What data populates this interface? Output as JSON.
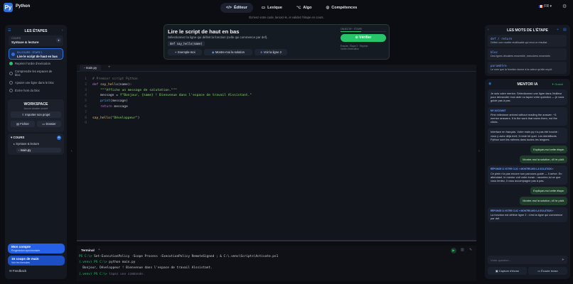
{
  "app": {
    "name": "Python",
    "logo_glyph": "Py"
  },
  "nav": {
    "tabs": [
      {
        "label": "Éditeur",
        "icon": "code-icon",
        "active": true
      },
      {
        "label": "Lexique",
        "icon": "book-icon",
        "active": false
      },
      {
        "label": "Algo",
        "icon": "diagram-icon",
        "active": false
      },
      {
        "label": "Compétences",
        "icon": "target-icon",
        "active": false
      }
    ],
    "subtitle": "Écrivez votre code, lancez-le, et validez l'étape en cours.",
    "lang": "FR",
    "lang_caret": "▾"
  },
  "left": {
    "title": "LES ÉTAPES",
    "course_label": "COURS",
    "course_value": "Syntaxe & lecture",
    "current_tag": "EN COURS · ÉTAPE 1",
    "current_label": "Lire le script de haut en bas",
    "steps": [
      "Repérer l'ordre d'exécution",
      "Comprendre les espaces de bloc",
      "Ajouter une ligne dans le bloc",
      "Écrire hors du bloc"
    ],
    "workspace_title": "WORKSPACE",
    "workspace_sub": "Aucun dossier ouvert",
    "import_label": "Importer son projet",
    "file_label": "Fichier",
    "folder_label": "Dossier",
    "tree_title": "COURS",
    "tree_folder": "Syntaxe & lecture",
    "tree_file": "main.py",
    "account_title": "Mon compte",
    "account_sub": "Progression synchronisée",
    "lessons_title": "15 coups de main",
    "lessons_sub": "Voir les formules",
    "feedback": "Feedback"
  },
  "instruction": {
    "title": "Lire le script de haut en bas",
    "desc": "Sélectionnez la ligne qui définit la fonction (celle qui commence par def).",
    "code_chip": "def say_hello(name)",
    "btn_example": "Exemple-moi",
    "btn_solution": "Montre-moi la solution",
    "btn_line": "Voir la ligne 2",
    "objective_label": "OBJECTIF · ÉTAPE",
    "verify": "Vérifier",
    "progress_note_1": "Ensuite : Étape 2 · Repérer",
    "progress_note_2": "l'ordre d'exécution",
    "progress": 0.45
  },
  "editor": {
    "tab": "main.py",
    "lines": [
      [
        {
          "t": "# Premier script Python",
          "c": "#6b7d6e"
        }
      ],
      [
        {
          "t": "def ",
          "c": "#c678dd"
        },
        {
          "t": "say_hello",
          "c": "#e5c07b"
        },
        {
          "t": "(name):",
          "c": "#c9cfdb"
        }
      ],
      [
        {
          "t": "    \"\"\"Affiche un message de salutation.\"\"\"",
          "c": "#8bd66b"
        }
      ],
      [
        {
          "t": "    message = ",
          "c": "#c9cfdb"
        },
        {
          "t": "f\"Bonjour, {name} ! Bienvenue dans l'espace de travail Alssistant.\"",
          "c": "#8bd66b"
        }
      ],
      [
        {
          "t": "    ",
          "c": "#c9cfdb"
        },
        {
          "t": "print",
          "c": "#61afef"
        },
        {
          "t": "(message)",
          "c": "#c9cfdb"
        }
      ],
      [
        {
          "t": "    ",
          "c": "#c9cfdb"
        },
        {
          "t": "return",
          "c": "#c678dd"
        },
        {
          "t": " message",
          "c": "#c9cfdb"
        }
      ],
      [],
      [
        {
          "t": "say_hello",
          "c": "#e5c07b"
        },
        {
          "t": "(",
          "c": "#c9cfdb"
        },
        {
          "t": "\"Développeur\"",
          "c": "#8bd66b"
        },
        {
          "t": ")",
          "c": "#c9cfdb"
        }
      ],
      []
    ]
  },
  "terminal": {
    "title": "Terminal",
    "lines": [
      [
        {
          "t": "PS C:\\> ",
          "c": "#29c46b"
        },
        {
          "t": "Set-ExecutionPolicy -Scope Process -ExecutionPolicy RemoteSigned ; & C:\\.venv\\Scripts\\Activate.ps1",
          "c": "#c9cfdb"
        }
      ],
      [
        {
          "t": "(.venv) PS C:\\> ",
          "c": "#29c46b"
        },
        {
          "t": "python main.py",
          "c": "#c9cfdb"
        }
      ],
      [
        {
          "t": "  Bonjour, Développeur ! Bienvenue dans l'espace de travail Alssistant.",
          "c": "#c9cfdb"
        }
      ],
      [
        {
          "t": "(.venv) PS C:\\> ",
          "c": "#29c46b"
        },
        {
          "t": "tapez une commande.",
          "c": "#6b7384"
        }
      ]
    ]
  },
  "right": {
    "words_title": "LES MOTS DE L'ÉTAPE",
    "words": [
      {
        "term": "def / return",
        "desc": "Définir une recette réutilisable qui rend un résultat."
      },
      {
        "term": "bloc",
        "desc": "Des lignes décalées ensemble, exécutées ensemble."
      },
      {
        "term": "paramètre",
        "desc": "Le nom que la fonction donne à la valeur qu'elle reçoit."
      }
    ],
    "mentor_title": "MENTOR IA",
    "mentor_badge": "Gratuit",
    "messages": [
      {
        "role": "bot",
        "text": "Je suis votre mentor. Sélectionnez une ligne dans l'éditeur pour demander mon aide ou tapez votre question — je vous guide pas à pas."
      },
      {
        "role": "bot",
        "tag": "MY ACCOUNT",
        "text": "First milestone arrived without reading the answer: +3 mentor answers. It is the work that earns them, not the clicks."
      },
      {
        "role": "bot",
        "text": "Interface en français. Votre main.py n'a pas été touché : vous y avez déjà écrit, il reste tel quel. Les identifiants Python sont les mêmes dans toutes les langues."
      },
      {
        "role": "user",
        "text": "Explique-moi cette étape."
      },
      {
        "role": "user",
        "text": "Montre-moi la solution, s'il te plaît."
      },
      {
        "role": "bot",
        "tag": "RÉPONSE À VOTRE CLIC « MONTRE-MOI LA SOLUTION »",
        "text": "Ce plein n'a pas encore son parcours guidé — il arrive. En attendant, le mentor voit votre écran : racontez-lui ce que vous tentez, il vous accompagne pas à pas."
      },
      {
        "role": "user",
        "text": "Explique-moi cette étape."
      },
      {
        "role": "user",
        "text": "Montre-moi la solution, s'il te plaît."
      },
      {
        "role": "bot",
        "tag": "RÉPONSE À VOTRE CLIC « MONTRE-MOI LA SOLUTION »",
        "text": "La fonction est définie ligne 2 : c'est la ligne qui commence par def."
      }
    ],
    "input_placeholder": "Votre question...",
    "capture_label": "Capture d'écran",
    "share_label": "Écoute écran"
  }
}
